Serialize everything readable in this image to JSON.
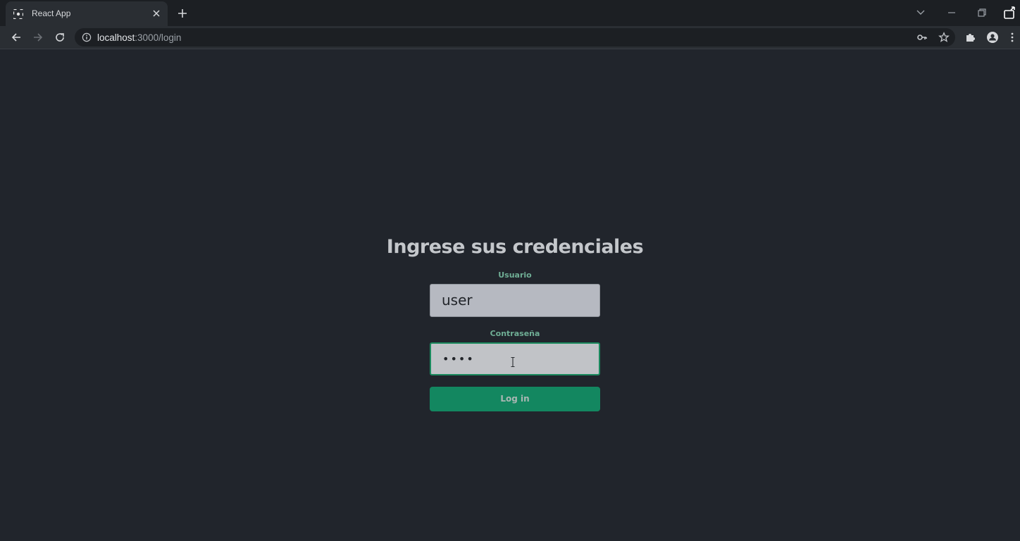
{
  "tab": {
    "title": "React App",
    "favicon": "react-logo-icon"
  },
  "address_bar": {
    "host": "localhost",
    "path": ":3000/login"
  },
  "login": {
    "title": "Ingrese sus credenciales",
    "username_label": "Usuario",
    "username_value": "user",
    "password_label": "Contraseña",
    "password_masked": "••••",
    "submit_label": "Log in"
  },
  "colors": {
    "page_background": "#21252c",
    "label_green": "#6fae95",
    "button_green": "#138760",
    "focus_border": "#1b8a5e"
  }
}
